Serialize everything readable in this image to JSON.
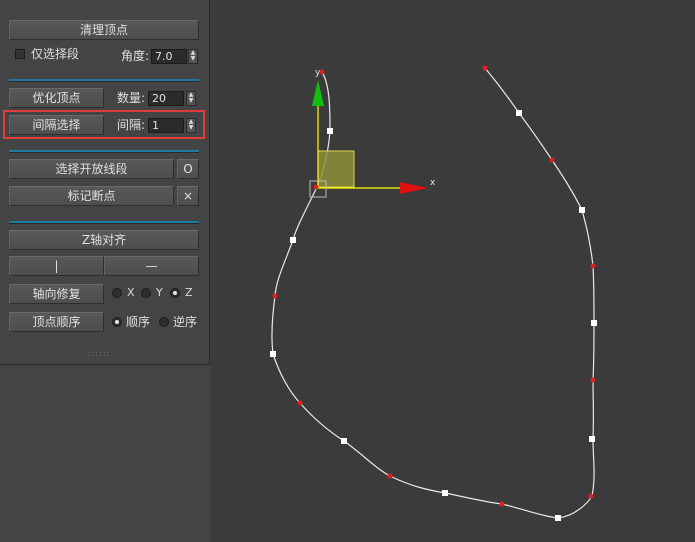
{
  "panel": {
    "clean_vertices": "清理顶点",
    "select_segment_only": "仅选择段",
    "angle_label": "角度:",
    "angle_value": "7.0",
    "optimize_vertices": "优化顶点",
    "count_label": "数量:",
    "count_value": "20",
    "interval_select": "间隔选择",
    "interval_label": "间隔:",
    "interval_value": "1",
    "select_open_segments": "选择开放线段",
    "o_button": "O",
    "mark_breakpoints": "标记断点",
    "x_button": "×",
    "z_align": "Z轴对齐",
    "vertical_button": "|",
    "horizontal_button": "—",
    "axis_repair": "轴向修复",
    "axis_x": "X",
    "axis_y": "Y",
    "axis_z": "Z",
    "axis_selected": "Z",
    "vertex_order": "顶点顺序",
    "order_forward": "顺序",
    "order_reverse": "逆序",
    "order_selected": "顺序",
    "grip": "::::::"
  },
  "viewport": {
    "gizmo_x_label": "x",
    "gizmo_y_label": "y",
    "colors": {
      "background": "#3b3b3b",
      "spline": "#e8e8e8",
      "vertex": "#ffffff",
      "knot": "#e02020",
      "axis_y": "#10c010",
      "axis_x": "#e01010",
      "gizmo_line": "#ffff00",
      "gizmo_plane": "#9a9a40"
    }
  }
}
